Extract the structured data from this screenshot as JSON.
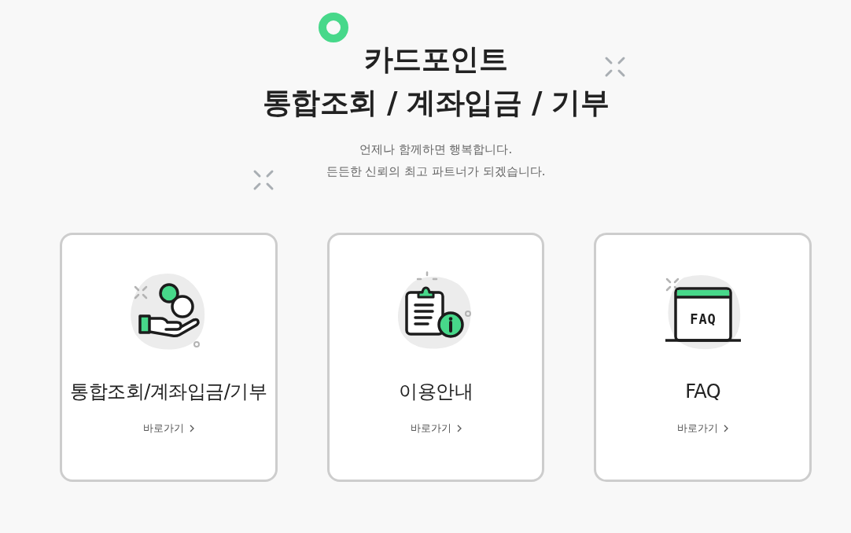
{
  "header": {
    "title_lines": [
      "카드포인트",
      "통합조회 / 계좌입금 / 기부"
    ],
    "subtitle_lines": [
      "언제나 함께하면 행복합니다.",
      "든든한 신뢰의 최고 파트너가 되겠습니다."
    ]
  },
  "cards": [
    {
      "kind": "hand-coins",
      "title": "통합조회/계좌입금/기부",
      "link": "바로가기"
    },
    {
      "kind": "clipboard-info",
      "title": "이용안내",
      "link": "바로가기"
    },
    {
      "kind": "faq-window",
      "title": "FAQ",
      "link": "바로가기",
      "icon_text": "FAQ"
    }
  ]
}
